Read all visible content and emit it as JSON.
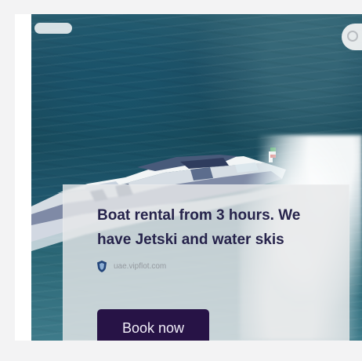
{
  "ad": {
    "badge_text": "",
    "headline": "Boat rental from 3 hours. We have Jetski and water skis",
    "source_domain": "uae.vipflot.com",
    "cta_label": "Book now"
  },
  "icons": {
    "source": "shield-icon",
    "corner": "circle-icon"
  },
  "colors": {
    "page_background": "#f3f3f4",
    "panel_background": "#e6e8e9",
    "headline_text": "#26234b",
    "button_background": "#271346",
    "button_text": "#f1eef8"
  }
}
